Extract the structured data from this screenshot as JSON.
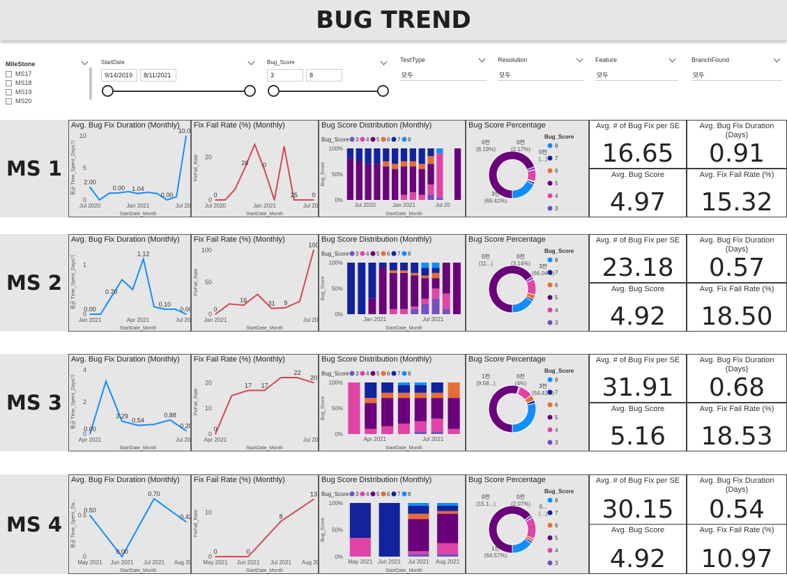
{
  "title": "BUG TREND",
  "filters": {
    "milestone": {
      "label": "MileStone",
      "options": [
        "MS17",
        "MS18",
        "MS19",
        "MS20"
      ]
    },
    "startdate": {
      "label": "StartDate",
      "from": "9/14/2019",
      "to": "8/11/2021"
    },
    "bugscore": {
      "label": "Bug_Score",
      "from": "3",
      "to": "8"
    },
    "dropdowns": [
      {
        "label": "TestType",
        "value": "모두"
      },
      {
        "label": "Resolution",
        "value": "모두"
      },
      {
        "label": "Feature",
        "value": "모두"
      },
      {
        "label": "BranchFound",
        "value": "모두"
      }
    ]
  },
  "panel_titles": {
    "duration": "Avg. Bug Fix Duration (Monthly)",
    "failrate": "Fix Fail Rate (%) (Monthly)",
    "dist": "Bug Score Distribution (Monthly)",
    "pct": "Bug Score Percentage",
    "kpi1": "Avg. # of Bug Fix per SE",
    "kpi2": "Avg. Bug Fix Duration (Days)",
    "kpi3": "Avg. Bug Score",
    "kpi4": "Avg. Fix Fail Rate (%)"
  },
  "axis_labels": {
    "startdate_month": "StartDate_Month",
    "fixfail_rate": "FixFail_Rate",
    "bug_score": "Bug_Score"
  },
  "legend_title": "Bug_Score",
  "legend_items": [
    "3",
    "4",
    "5",
    "6",
    "7",
    "8"
  ],
  "colors": {
    "score3": "#744ec2",
    "score4": "#e044a7",
    "score5": "#6b007b",
    "score6": "#e66c37",
    "score7": "#12239e",
    "score8": "#118dff",
    "duration_line": "#118dff",
    "fail_line": "#d64550"
  },
  "rows": [
    {
      "label": "MS 1",
      "kpi": {
        "fix_per_se": "16.65",
        "fix_duration": "0.91",
        "bug_score": "4.97",
        "fail_rate": "15.32"
      },
      "chart_data": {
        "duration": {
          "type": "line",
          "ylabel": "평균 Time_Spent_Days기",
          "ylim": [
            0,
            10
          ],
          "yticks": [
            "0",
            "5",
            "10"
          ],
          "xticks": [
            "Jul 2020",
            "Jan 2021",
            "Jul 2021"
          ],
          "values": [
            2.0,
            0.0,
            1.04,
            1.1,
            1.3,
            1.0,
            1.2,
            1.0,
            0.0,
            0.5,
            10.0
          ],
          "labels": [
            "2.00",
            "0.00",
            "1.04",
            "0.00",
            "10.00"
          ]
        },
        "failrate": {
          "type": "line",
          "ylim": [
            0,
            30
          ],
          "yticks": [
            "0",
            "20"
          ],
          "xticks": [
            "Jul 2020",
            "Jan 2021",
            "Jul 2021"
          ],
          "values": [
            0,
            0,
            5,
            15,
            26,
            14,
            0,
            25,
            0,
            0,
            0
          ],
          "labels": [
            "0",
            "26",
            "0",
            "25",
            "0"
          ]
        },
        "dist": {
          "type": "bar",
          "yticks": [
            "0%",
            "50%",
            "100%"
          ],
          "xticks": [
            "Jul 2020",
            "Jan 2021",
            "Jul 20"
          ],
          "series_colors": [
            "#744ec2",
            "#e044a7",
            "#6b007b",
            "#e66c37",
            "#12239e",
            "#118dff"
          ],
          "bars": [
            [
              0,
              0,
              0.8,
              0,
              0.2,
              0
            ],
            [
              0,
              0,
              0.75,
              0,
              0.25,
              0
            ],
            [
              0,
              0,
              0.7,
              0,
              0.3,
              0
            ],
            [
              0,
              0,
              0.7,
              0,
              0.3,
              0
            ],
            [
              0,
              0,
              0.65,
              0.1,
              0.25,
              0
            ],
            [
              0,
              0,
              0.6,
              0.1,
              0.3,
              0
            ],
            [
              0,
              0.1,
              0.55,
              0.1,
              0.25,
              0
            ],
            [
              0,
              0.15,
              0.5,
              0.1,
              0.25,
              0
            ],
            [
              0,
              0.1,
              0.5,
              0.1,
              0.3,
              0
            ],
            [
              0.1,
              0.2,
              0.4,
              0.15,
              0.15,
              0
            ],
            [
              0.05,
              0.85,
              0,
              0,
              0,
              0.1
            ],
            [
              0,
              0,
              0,
              0,
              0,
              0
            ],
            [
              0,
              0,
              1.0,
              0,
              0,
              0
            ]
          ]
        },
        "pct": {
          "type": "pie",
          "slices": [
            2.0,
            8.19,
            69.42,
            0.5,
            1.5,
            18.39
          ],
          "labels": [
            {
              "t": "0천",
              "s": "(8.19%)"
            },
            {
              "t": "0천",
              "s": "(2.17%)"
            },
            {
              "t": "0천",
              "s": "(...)"
            },
            {
              "t": "3천",
              "s": "(69.42%)"
            }
          ]
        }
      }
    },
    {
      "label": "MS 2",
      "kpi": {
        "fix_per_se": "23.18",
        "fix_duration": "0.57",
        "bug_score": "4.92",
        "fail_rate": "18.50"
      },
      "chart_data": {
        "duration": {
          "type": "line",
          "ylabel": "평균 Time_Spent_Days기",
          "ylim": [
            0,
            1.3
          ],
          "yticks": [
            "0",
            "1"
          ],
          "xticks": [
            "Jan 2021",
            "Apr 2021",
            "Jul 2021"
          ],
          "values": [
            0.0,
            0.0,
            0.35,
            0.7,
            0.5,
            1.12,
            0.15,
            0.1,
            0.1,
            0.0
          ],
          "labels": [
            "0.00",
            "0.70",
            "1.12",
            "0.10",
            "0.00"
          ]
        },
        "failrate": {
          "type": "line",
          "ylim": [
            0,
            100
          ],
          "yticks": [
            "0",
            "50",
            "100"
          ],
          "xticks": [
            "Jan 2021",
            "Jul 2021"
          ],
          "values": [
            0,
            16,
            14,
            31,
            9,
            10,
            20,
            100
          ],
          "labels": [
            "0",
            "16",
            "31",
            "9",
            "100"
          ]
        },
        "dist": {
          "type": "bar",
          "yticks": [
            "0%",
            "50%",
            "100%"
          ],
          "xticks": [
            "Jan 2021",
            "Jul 2021"
          ],
          "series_colors": [
            "#744ec2",
            "#e044a7",
            "#6b007b",
            "#e66c37",
            "#12239e",
            "#118dff"
          ],
          "bars": [
            [
              0,
              0,
              0,
              0,
              1.0,
              0
            ],
            [
              0,
              0,
              0,
              0,
              1.0,
              0
            ],
            [
              0,
              0,
              0.3,
              0,
              0.7,
              0
            ],
            [
              0,
              0,
              0.9,
              0,
              0.1,
              0
            ],
            [
              0,
              0.1,
              0.7,
              0.05,
              0.15,
              0
            ],
            [
              0,
              0.1,
              0.7,
              0.05,
              0.15,
              0
            ],
            [
              0.1,
              0.05,
              0.6,
              0.05,
              0.2,
              0
            ],
            [
              0.2,
              0.1,
              0.4,
              0.05,
              0.15,
              0.1
            ],
            [
              0.3,
              0.2,
              0.2,
              0.1,
              0.1,
              0.1
            ],
            [
              0.1,
              0.3,
              0.6,
              0,
              0,
              0
            ],
            [
              0,
              0,
              1.0,
              0,
              0,
              0
            ]
          ]
        },
        "pct": {
          "type": "pie",
          "slices": [
            2.0,
            11.0,
            66.04,
            3.14,
            1.5,
            16.32
          ],
          "labels": [
            {
              "t": "0천",
              "s": "(11...)"
            },
            {
              "t": "0천",
              "s": "(3.14%)"
            },
            {
              "t": "3천",
              "s": "(66.04%)"
            }
          ]
        }
      }
    },
    {
      "label": "MS 3",
      "kpi": {
        "fix_per_se": "31.91",
        "fix_duration": "0.68",
        "bug_score": "5.16",
        "fail_rate": "18.53"
      },
      "chart_data": {
        "duration": {
          "type": "line",
          "ylabel": "평균 Time_Spent_Days기",
          "ylim": [
            0,
            4
          ],
          "yticks": [
            "0",
            "2",
            "4"
          ],
          "xticks": [
            "Apr 2021",
            "Jul 2021"
          ],
          "values": [
            0.0,
            3.29,
            0.8,
            0.54,
            0.6,
            0.88,
            0.2
          ],
          "labels": [
            "0.00",
            "3.29",
            "0.54",
            "0.88",
            "0.20"
          ]
        },
        "failrate": {
          "type": "line",
          "ylim": [
            0,
            25
          ],
          "yticks": [
            "0",
            "10",
            "20"
          ],
          "xticks": [
            "Apr 2021",
            "Jul 2021"
          ],
          "values": [
            0,
            15,
            17,
            17,
            22,
            22,
            20
          ],
          "labels": [
            "0",
            "17",
            "17",
            "22",
            "20"
          ]
        },
        "dist": {
          "type": "bar",
          "yticks": [
            "0%",
            "50%",
            "100%"
          ],
          "xticks": [
            "Apr 2021",
            "Jul 2021"
          ],
          "series_colors": [
            "#744ec2",
            "#e044a7",
            "#6b007b",
            "#e66c37",
            "#12239e",
            "#118dff"
          ],
          "bars": [
            [
              0,
              1.0,
              0,
              0,
              0,
              0
            ],
            [
              0,
              0.1,
              0.5,
              0.1,
              0.3,
              0
            ],
            [
              0,
              0.15,
              0.55,
              0.1,
              0.2,
              0
            ],
            [
              0,
              0.2,
              0.5,
              0.1,
              0.15,
              0.05
            ],
            [
              0.05,
              0.2,
              0.45,
              0.1,
              0.15,
              0.05
            ],
            [
              0.05,
              0.25,
              0.4,
              0.1,
              0.2,
              0
            ],
            [
              0,
              0.1,
              0.6,
              0.3,
              0,
              0
            ]
          ]
        },
        "pct": {
          "type": "pie",
          "slices": [
            1.0,
            9.58,
            54.43,
            4.0,
            2.0,
            28.99
          ],
          "labels": [
            {
              "t": "1천",
              "s": "(9.58...)"
            },
            {
              "t": "0천",
              "s": "(4%)"
            },
            {
              "t": "3천",
              "s": "(54.43...)"
            }
          ]
        }
      }
    },
    {
      "label": "MS 4",
      "kpi": {
        "fix_per_se": "30.15",
        "fix_duration": "0.54",
        "bug_score": "4.92",
        "fail_rate": "10.97"
      },
      "chart_data": {
        "duration": {
          "type": "line",
          "ylabel": "평균 Time_Spent_Da...",
          "ylim": [
            0,
            0.8
          ],
          "yticks": [
            "0",
            "0.5"
          ],
          "xticks": [
            "May 2021",
            "Jun 2021",
            "Jul 2021",
            "Aug 2021"
          ],
          "values": [
            0.5,
            0.0,
            0.7,
            0.42
          ],
          "labels": [
            "0.50",
            "0.00",
            "0.70",
            "0.42"
          ]
        },
        "failrate": {
          "type": "line",
          "ylim": [
            0,
            15
          ],
          "yticks": [
            "0",
            "10"
          ],
          "xticks": [
            "May 2021",
            "Jun 2021",
            "Jul 2021",
            "Aug 2021"
          ],
          "values": [
            0,
            0,
            8,
            13
          ],
          "labels": [
            "0",
            "0",
            "8",
            "13"
          ]
        },
        "dist": {
          "type": "bar",
          "yticks": [
            "0%",
            "50%",
            "100%"
          ],
          "xticks": [
            "May 2021",
            "Jun 2021",
            "Jul 2021",
            "Aug 2021"
          ],
          "series_colors": [
            "#744ec2",
            "#e044a7",
            "#6b007b",
            "#e66c37",
            "#12239e",
            "#118dff"
          ],
          "bars": [
            [
              0,
              0.35,
              0,
              0,
              0.65,
              0
            ],
            [
              0,
              0,
              0,
              0,
              1.0,
              0
            ],
            [
              0.05,
              0.05,
              0.6,
              0.1,
              0.15,
              0.05
            ],
            [
              0.05,
              0.2,
              0.55,
              0.05,
              0.1,
              0.05
            ]
          ]
        },
        "pct": {
          "type": "pie",
          "slices": [
            2.0,
            15.1,
            64.57,
            2.07,
            1.5,
            14.76
          ],
          "labels": [
            {
              "t": "0천",
              "s": "(15.1...)"
            },
            {
              "t": "0천",
              "s": "(2.07%)"
            },
            {
              "t": "0...",
              "s": "(...)"
            },
            {
              "t": "1천",
              "s": "(64.57%)"
            }
          ]
        }
      }
    }
  ]
}
